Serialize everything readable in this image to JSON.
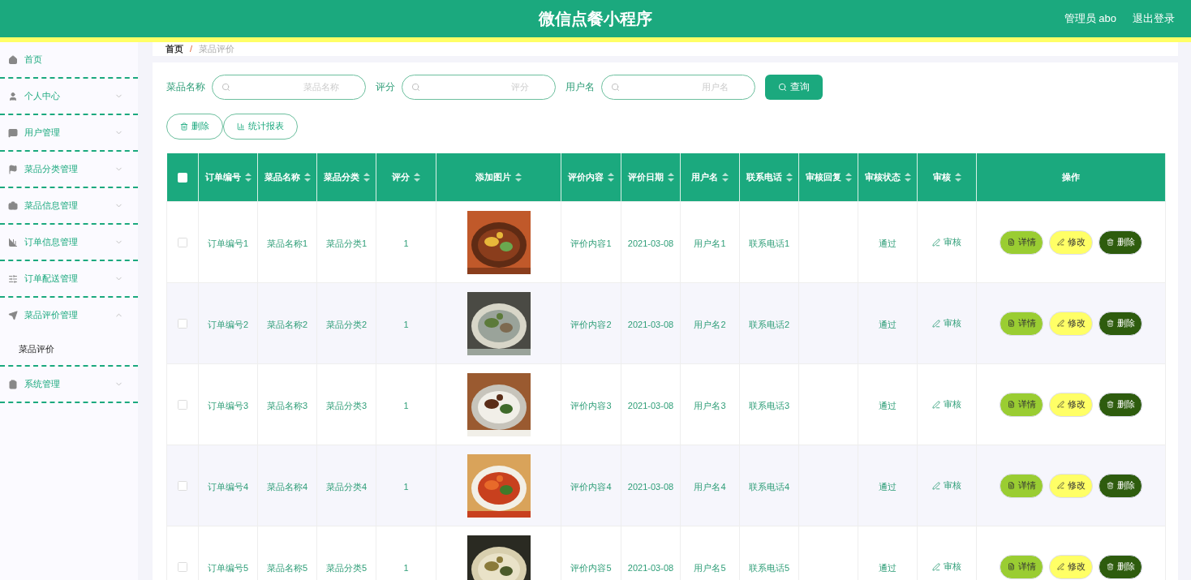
{
  "header": {
    "title": "微信点餐小程序",
    "user": "管理员 abo",
    "logout": "退出登录"
  },
  "sidebar": [
    {
      "kind": "link",
      "label": "首页"
    },
    {
      "kind": "menu",
      "label": "个人中心",
      "expanded": false
    },
    {
      "kind": "menu",
      "label": "用户管理",
      "expanded": false
    },
    {
      "kind": "menu",
      "label": "菜品分类管理",
      "expanded": false
    },
    {
      "kind": "menu",
      "label": "菜品信息管理",
      "expanded": false
    },
    {
      "kind": "menu",
      "label": "订单信息管理",
      "expanded": false
    },
    {
      "kind": "menu",
      "label": "订单配送管理",
      "expanded": false
    },
    {
      "kind": "menu",
      "label": "菜品评价管理",
      "expanded": true,
      "children": [
        {
          "label": "菜品评价"
        }
      ]
    },
    {
      "kind": "menu",
      "label": "系统管理",
      "expanded": false
    }
  ],
  "breadcrumb": [
    "首页",
    "/",
    "菜品评价"
  ],
  "search": [
    {
      "label": "菜品名称",
      "placeholder": "菜品名称"
    },
    {
      "label": "评分",
      "placeholder": "评分"
    },
    {
      "label": "用户名",
      "placeholder": "用户名"
    }
  ],
  "query_button": "查询",
  "actions": [
    {
      "kind": "delete",
      "label": "删除"
    },
    {
      "kind": "report",
      "label": "统计报表"
    }
  ],
  "table": {
    "columns": [
      {
        "kind": "check",
        "checked": false
      },
      {
        "label": "订单编号",
        "sortable": true
      },
      {
        "label": "菜品名称",
        "sortable": true
      },
      {
        "label": "菜品分类",
        "sortable": true
      },
      {
        "label": "评分",
        "sortable": true
      },
      {
        "label": "添加图片",
        "sortable": true
      },
      {
        "label": "评价内容",
        "sortable": true
      },
      {
        "label": "评价日期",
        "sortable": true
      },
      {
        "label": "用户名",
        "sortable": true
      },
      {
        "label": "联系电话",
        "sortable": true
      },
      {
        "label": "审核回复",
        "sortable": true
      },
      {
        "label": "审核状态",
        "sortable": true
      },
      {
        "label": "审核",
        "sortable": true
      },
      {
        "label": "操作",
        "sortable": false
      }
    ],
    "rows": [
      {
        "cells": [
          {
            "kind": "check",
            "checked": false
          },
          {
            "kind": "text",
            "text": "订单编号1"
          },
          {
            "kind": "text",
            "text": "菜品名称1"
          },
          {
            "kind": "text",
            "text": "菜品分类1"
          },
          {
            "kind": "text",
            "text": "1"
          },
          {
            "kind": "picture"
          },
          {
            "kind": "text",
            "text": "评价内容1"
          },
          {
            "kind": "text",
            "text": "2021-03-08"
          },
          {
            "kind": "text",
            "text": "用户名1"
          },
          {
            "kind": "text",
            "text": "联系电话1"
          },
          {
            "kind": "empty"
          },
          {
            "kind": "text",
            "text": "通过"
          },
          {
            "kind": "link",
            "text": "审核"
          },
          {
            "kind": "actions",
            "buttons": [
              "详情",
              "修改",
              "删除"
            ]
          }
        ]
      },
      {
        "cells": [
          {
            "kind": "check",
            "checked": false
          },
          {
            "kind": "text",
            "text": "订单编号2"
          },
          {
            "kind": "text",
            "text": "菜品名称2"
          },
          {
            "kind": "text",
            "text": "菜品分类2"
          },
          {
            "kind": "text",
            "text": "1"
          },
          {
            "kind": "picture"
          },
          {
            "kind": "text",
            "text": "评价内容2"
          },
          {
            "kind": "text",
            "text": "2021-03-08"
          },
          {
            "kind": "text",
            "text": "用户名2"
          },
          {
            "kind": "text",
            "text": "联系电话2"
          },
          {
            "kind": "empty"
          },
          {
            "kind": "text",
            "text": "通过"
          },
          {
            "kind": "link",
            "text": "审核"
          },
          {
            "kind": "actions",
            "buttons": [
              "详情",
              "修改",
              "删除"
            ]
          }
        ]
      },
      {
        "cells": [
          {
            "kind": "check",
            "checked": false
          },
          {
            "kind": "text",
            "text": "订单编号3"
          },
          {
            "kind": "text",
            "text": "菜品名称3"
          },
          {
            "kind": "text",
            "text": "菜品分类3"
          },
          {
            "kind": "text",
            "text": "1"
          },
          {
            "kind": "picture"
          },
          {
            "kind": "text",
            "text": "评价内容3"
          },
          {
            "kind": "text",
            "text": "2021-03-08"
          },
          {
            "kind": "text",
            "text": "用户名3"
          },
          {
            "kind": "text",
            "text": "联系电话3"
          },
          {
            "kind": "empty"
          },
          {
            "kind": "text",
            "text": "通过"
          },
          {
            "kind": "link",
            "text": "审核"
          },
          {
            "kind": "actions",
            "buttons": [
              "详情",
              "修改",
              "删除"
            ]
          }
        ]
      },
      {
        "cells": [
          {
            "kind": "check",
            "checked": false
          },
          {
            "kind": "text",
            "text": "订单编号4"
          },
          {
            "kind": "text",
            "text": "菜品名称4"
          },
          {
            "kind": "text",
            "text": "菜品分类4"
          },
          {
            "kind": "text",
            "text": "1"
          },
          {
            "kind": "picture"
          },
          {
            "kind": "text",
            "text": "评价内容4"
          },
          {
            "kind": "text",
            "text": "2021-03-08"
          },
          {
            "kind": "text",
            "text": "用户名4"
          },
          {
            "kind": "text",
            "text": "联系电话4"
          },
          {
            "kind": "empty"
          },
          {
            "kind": "text",
            "text": "通过"
          },
          {
            "kind": "link",
            "text": "审核"
          },
          {
            "kind": "actions",
            "buttons": [
              "详情",
              "修改",
              "删除"
            ]
          }
        ]
      },
      {
        "cells": [
          {
            "kind": "check",
            "checked": false
          },
          {
            "kind": "text",
            "text": "订单编号5"
          },
          {
            "kind": "text",
            "text": "菜品名称5"
          },
          {
            "kind": "text",
            "text": "菜品分类5"
          },
          {
            "kind": "text",
            "text": "1"
          },
          {
            "kind": "picture"
          },
          {
            "kind": "text",
            "text": "评价内容5"
          },
          {
            "kind": "text",
            "text": "2021-03-08"
          },
          {
            "kind": "text",
            "text": "用户名5"
          },
          {
            "kind": "text",
            "text": "联系电话5"
          },
          {
            "kind": "empty"
          },
          {
            "kind": "text",
            "text": "通过"
          },
          {
            "kind": "link",
            "text": "审核"
          },
          {
            "kind": "actions",
            "buttons": [
              "详情",
              "修改",
              "删除"
            ]
          }
        ]
      }
    ]
  }
}
